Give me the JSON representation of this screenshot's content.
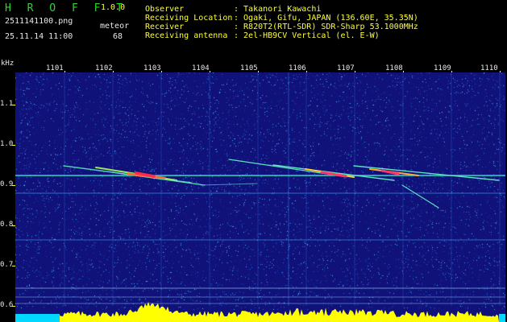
{
  "header": {
    "brand": "H R O F F T",
    "version": "1.0.0",
    "filename": "2511141100.png",
    "datetime": "25.11.14 11:00",
    "detection_label": "meteor",
    "detection_count": "68"
  },
  "meta": [
    {
      "key": "Observer",
      "value": ": Takanori Kawachi"
    },
    {
      "key": "Receiving Location",
      "value": ": Ogaki, Gifu, JAPAN (136.60E, 35.35N)"
    },
    {
      "key": "Receiver",
      "value": ": R820T2(RTL-SDR) SDR-Sharp 53.1000MHz"
    },
    {
      "key": "Receiving antenna",
      "value": ": 2el-HB9CV Vertical (el. E-W)"
    }
  ],
  "axes": {
    "y_unit": "kHz",
    "y_ticks": [
      "1.1",
      "1.0",
      "0.9",
      "0.8",
      "0.7",
      "0.6"
    ],
    "x_ticks": [
      "1101",
      "1102",
      "1103",
      "1104",
      "1105",
      "1106",
      "1107",
      "1108",
      "1109",
      "1110"
    ]
  },
  "colors": {
    "background": "#000000",
    "spectrogram_bg": "#10127a",
    "noise": "#2f9fe8",
    "carrier": "#33ffcc",
    "echo_hot": "#ff3333",
    "level_bar": "#ffff00",
    "label_green": "#2fd52f",
    "label_yellow": "#ffff33"
  }
}
